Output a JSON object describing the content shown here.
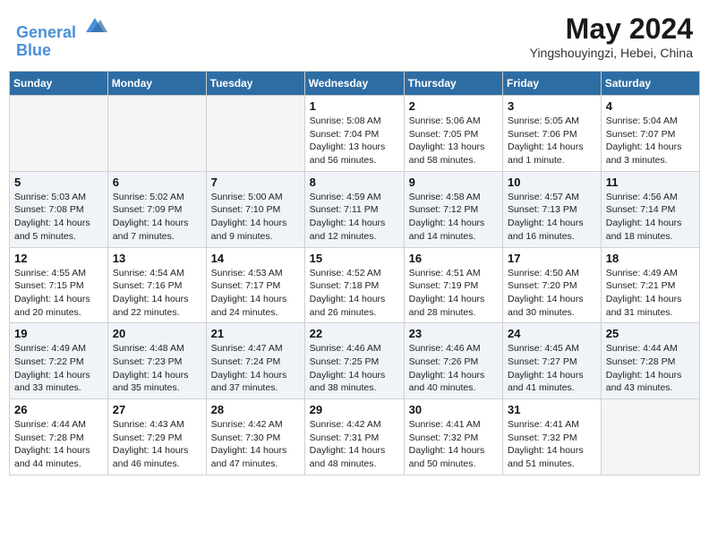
{
  "header": {
    "logo_line1": "General",
    "logo_line2": "Blue",
    "month": "May 2024",
    "location": "Yingshouyingzi, Hebei, China"
  },
  "days_of_week": [
    "Sunday",
    "Monday",
    "Tuesday",
    "Wednesday",
    "Thursday",
    "Friday",
    "Saturday"
  ],
  "weeks": [
    [
      {
        "day": "",
        "info": []
      },
      {
        "day": "",
        "info": []
      },
      {
        "day": "",
        "info": []
      },
      {
        "day": "1",
        "info": [
          "Sunrise: 5:08 AM",
          "Sunset: 7:04 PM",
          "Daylight: 13 hours",
          "and 56 minutes."
        ]
      },
      {
        "day": "2",
        "info": [
          "Sunrise: 5:06 AM",
          "Sunset: 7:05 PM",
          "Daylight: 13 hours",
          "and 58 minutes."
        ]
      },
      {
        "day": "3",
        "info": [
          "Sunrise: 5:05 AM",
          "Sunset: 7:06 PM",
          "Daylight: 14 hours",
          "and 1 minute."
        ]
      },
      {
        "day": "4",
        "info": [
          "Sunrise: 5:04 AM",
          "Sunset: 7:07 PM",
          "Daylight: 14 hours",
          "and 3 minutes."
        ]
      }
    ],
    [
      {
        "day": "5",
        "info": [
          "Sunrise: 5:03 AM",
          "Sunset: 7:08 PM",
          "Daylight: 14 hours",
          "and 5 minutes."
        ]
      },
      {
        "day": "6",
        "info": [
          "Sunrise: 5:02 AM",
          "Sunset: 7:09 PM",
          "Daylight: 14 hours",
          "and 7 minutes."
        ]
      },
      {
        "day": "7",
        "info": [
          "Sunrise: 5:00 AM",
          "Sunset: 7:10 PM",
          "Daylight: 14 hours",
          "and 9 minutes."
        ]
      },
      {
        "day": "8",
        "info": [
          "Sunrise: 4:59 AM",
          "Sunset: 7:11 PM",
          "Daylight: 14 hours",
          "and 12 minutes."
        ]
      },
      {
        "day": "9",
        "info": [
          "Sunrise: 4:58 AM",
          "Sunset: 7:12 PM",
          "Daylight: 14 hours",
          "and 14 minutes."
        ]
      },
      {
        "day": "10",
        "info": [
          "Sunrise: 4:57 AM",
          "Sunset: 7:13 PM",
          "Daylight: 14 hours",
          "and 16 minutes."
        ]
      },
      {
        "day": "11",
        "info": [
          "Sunrise: 4:56 AM",
          "Sunset: 7:14 PM",
          "Daylight: 14 hours",
          "and 18 minutes."
        ]
      }
    ],
    [
      {
        "day": "12",
        "info": [
          "Sunrise: 4:55 AM",
          "Sunset: 7:15 PM",
          "Daylight: 14 hours",
          "and 20 minutes."
        ]
      },
      {
        "day": "13",
        "info": [
          "Sunrise: 4:54 AM",
          "Sunset: 7:16 PM",
          "Daylight: 14 hours",
          "and 22 minutes."
        ]
      },
      {
        "day": "14",
        "info": [
          "Sunrise: 4:53 AM",
          "Sunset: 7:17 PM",
          "Daylight: 14 hours",
          "and 24 minutes."
        ]
      },
      {
        "day": "15",
        "info": [
          "Sunrise: 4:52 AM",
          "Sunset: 7:18 PM",
          "Daylight: 14 hours",
          "and 26 minutes."
        ]
      },
      {
        "day": "16",
        "info": [
          "Sunrise: 4:51 AM",
          "Sunset: 7:19 PM",
          "Daylight: 14 hours",
          "and 28 minutes."
        ]
      },
      {
        "day": "17",
        "info": [
          "Sunrise: 4:50 AM",
          "Sunset: 7:20 PM",
          "Daylight: 14 hours",
          "and 30 minutes."
        ]
      },
      {
        "day": "18",
        "info": [
          "Sunrise: 4:49 AM",
          "Sunset: 7:21 PM",
          "Daylight: 14 hours",
          "and 31 minutes."
        ]
      }
    ],
    [
      {
        "day": "19",
        "info": [
          "Sunrise: 4:49 AM",
          "Sunset: 7:22 PM",
          "Daylight: 14 hours",
          "and 33 minutes."
        ]
      },
      {
        "day": "20",
        "info": [
          "Sunrise: 4:48 AM",
          "Sunset: 7:23 PM",
          "Daylight: 14 hours",
          "and 35 minutes."
        ]
      },
      {
        "day": "21",
        "info": [
          "Sunrise: 4:47 AM",
          "Sunset: 7:24 PM",
          "Daylight: 14 hours",
          "and 37 minutes."
        ]
      },
      {
        "day": "22",
        "info": [
          "Sunrise: 4:46 AM",
          "Sunset: 7:25 PM",
          "Daylight: 14 hours",
          "and 38 minutes."
        ]
      },
      {
        "day": "23",
        "info": [
          "Sunrise: 4:46 AM",
          "Sunset: 7:26 PM",
          "Daylight: 14 hours",
          "and 40 minutes."
        ]
      },
      {
        "day": "24",
        "info": [
          "Sunrise: 4:45 AM",
          "Sunset: 7:27 PM",
          "Daylight: 14 hours",
          "and 41 minutes."
        ]
      },
      {
        "day": "25",
        "info": [
          "Sunrise: 4:44 AM",
          "Sunset: 7:28 PM",
          "Daylight: 14 hours",
          "and 43 minutes."
        ]
      }
    ],
    [
      {
        "day": "26",
        "info": [
          "Sunrise: 4:44 AM",
          "Sunset: 7:28 PM",
          "Daylight: 14 hours",
          "and 44 minutes."
        ]
      },
      {
        "day": "27",
        "info": [
          "Sunrise: 4:43 AM",
          "Sunset: 7:29 PM",
          "Daylight: 14 hours",
          "and 46 minutes."
        ]
      },
      {
        "day": "28",
        "info": [
          "Sunrise: 4:42 AM",
          "Sunset: 7:30 PM",
          "Daylight: 14 hours",
          "and 47 minutes."
        ]
      },
      {
        "day": "29",
        "info": [
          "Sunrise: 4:42 AM",
          "Sunset: 7:31 PM",
          "Daylight: 14 hours",
          "and 48 minutes."
        ]
      },
      {
        "day": "30",
        "info": [
          "Sunrise: 4:41 AM",
          "Sunset: 7:32 PM",
          "Daylight: 14 hours",
          "and 50 minutes."
        ]
      },
      {
        "day": "31",
        "info": [
          "Sunrise: 4:41 AM",
          "Sunset: 7:32 PM",
          "Daylight: 14 hours",
          "and 51 minutes."
        ]
      },
      {
        "day": "",
        "info": []
      }
    ]
  ]
}
